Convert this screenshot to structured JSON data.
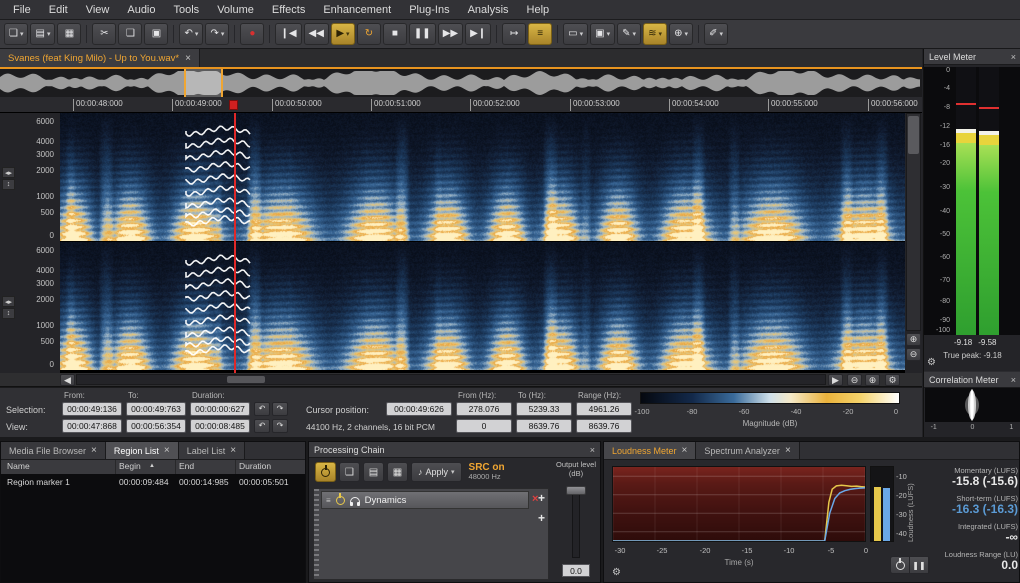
{
  "colors": {
    "accent_orange": "#f0a632",
    "meter_green": "#3cc43c",
    "shortterm_blue": "#5b9bd5",
    "momentary_yellow": "#e6c84b",
    "playhead_red": "#e02828"
  },
  "menu": {
    "items": [
      "File",
      "Edit",
      "View",
      "Audio",
      "Tools",
      "Volume",
      "Effects",
      "Enhancement",
      "Plug-Ins",
      "Analysis",
      "Help"
    ]
  },
  "icons": {
    "new_file": "❏",
    "open_folder": "▤",
    "save": "▦",
    "cut": "✂",
    "copy": "❑",
    "paste": "▣",
    "undo": "↶",
    "redo": "↷",
    "record": "●",
    "go_start": "❙◀",
    "rewind": "◀◀",
    "play": "▶",
    "loop": "↻",
    "stop": "■",
    "pause": "❚❚",
    "fast_forward": "▶▶",
    "go_end": "▶❙",
    "follow_playback": "↦",
    "spectrogram_view": "≡",
    "selection_tool": "▭",
    "region_tool": "▣",
    "draw_tool": "✎",
    "harmonics_tool": "≋",
    "zoom_tool": "⊕",
    "retouch_tool": "✐",
    "dropdown": "▾",
    "close": "×",
    "sort_asc": "▲",
    "zoom_in": "⊕",
    "zoom_out": "⊖",
    "settings": "⚙",
    "speaker": "♪",
    "drag_handle": "≡",
    "scroll_left": "◀",
    "scroll_right": "▶",
    "channel_updown": "↕",
    "channel_leftright": "◂▸",
    "remove": "×",
    "add": "+"
  },
  "document_tab": {
    "title": "Svanes (feat King Milo) - Up to You.wav*"
  },
  "timeline": {
    "labels": [
      "00:00:48:000",
      "00:00:49:000",
      "00:00:50:000",
      "00:00:51:000",
      "00:00:52:000",
      "00:00:53:000",
      "00:00:54:000",
      "00:00:55:000",
      "00:00:56:000"
    ]
  },
  "spectrogram": {
    "freq_labels": [
      "6000",
      "4000",
      "3000",
      "2000",
      "1000",
      "500",
      "0"
    ]
  },
  "info": {
    "headers": {
      "from": "From:",
      "to": "To:",
      "duration": "Duration:"
    },
    "selection": {
      "label": "Selection:",
      "from": "00:00:49:136",
      "to": "00:00:49:763",
      "duration": "00:00:00:627"
    },
    "view": {
      "label": "View:",
      "from": "00:00:47:868",
      "to": "00:00:56:354",
      "duration": "00:00:08:485"
    },
    "cursor_label": "Cursor position:",
    "cursor_value": "00:00:49:626",
    "format": "44100 Hz, 2 channels, 16 bit PCM",
    "freq_headers": {
      "from": "From (Hz):",
      "to": "To (Hz):",
      "range": "Range (Hz):"
    },
    "freq_selection": {
      "from": "278.076",
      "to": "5239.33",
      "range": "4961.26"
    },
    "freq_view": {
      "from": "0",
      "to": "8639.76",
      "range": "8639.76"
    },
    "magnitude_label": "Magnitude (dB)",
    "magnitude_ticks": [
      "-100",
      "-80",
      "-60",
      "-40",
      "-20",
      "0"
    ]
  },
  "level_meter": {
    "title": "Level Meter",
    "scale": [
      "0",
      "-4",
      "-8",
      "-12",
      "-16",
      "-20",
      "-30",
      "-40",
      "-50",
      "-60",
      "-70",
      "-80",
      "-90",
      "-100"
    ],
    "value_left": "-9.18",
    "value_right": "-9.58",
    "true_peak": "True peak: -9.18"
  },
  "correlation_meter": {
    "title": "Correlation Meter",
    "scale": [
      "-1",
      "0",
      "1"
    ]
  },
  "region_panel": {
    "tabs": [
      {
        "label": "Media File Browser"
      },
      {
        "label": "Region List"
      },
      {
        "label": "Label List"
      }
    ],
    "columns": [
      "Name",
      "Begin",
      "End",
      "Duration"
    ],
    "rows": [
      {
        "name": "Region marker 1",
        "begin": "00:00:09:484",
        "end": "00:00:14:985",
        "duration": "00:00:05:501"
      }
    ]
  },
  "processing_chain": {
    "title": "Processing Chain",
    "apply_label": "Apply",
    "src_status": "SRC on",
    "src_rate": "48000 Hz",
    "output_label": "Output level (dB)",
    "output_value": "0.0",
    "items": [
      {
        "name": "Dynamics"
      }
    ]
  },
  "analysis_panel": {
    "tabs": [
      {
        "label": "Loudness Meter"
      },
      {
        "label": "Spectrum Analyzer"
      }
    ],
    "stats": [
      {
        "label": "Momentary (LUFS)",
        "value": "-15.8 (-15.6)"
      },
      {
        "label": "Short-term (LUFS)",
        "value": "-16.3 (-16.3)"
      },
      {
        "label": "Integrated (LUFS)",
        "value": "-∞"
      },
      {
        "label": "Loudness Range (LU)",
        "value": "0.0"
      }
    ]
  },
  "chart_data": {
    "type": "line",
    "title": "Loudness history",
    "xlabel": "Time (s)",
    "ylabel": "Loudness (LUFS)",
    "xlim": [
      -30,
      0
    ],
    "ylim": [
      -45,
      -5
    ],
    "xticks": [
      -30,
      -25,
      -20,
      -15,
      -10,
      -5,
      0
    ],
    "yticks": [
      -10,
      -20,
      -30,
      -40
    ],
    "grid": true,
    "legend": "none",
    "series": [
      {
        "name": "Momentary (LUFS)",
        "color": "#e6c84b",
        "points": [
          [
            -30,
            -45
          ],
          [
            -4.8,
            -45
          ],
          [
            -4.3,
            -24
          ],
          [
            -3.9,
            -17
          ],
          [
            -3.4,
            -15.2
          ],
          [
            -2.8,
            -14.9
          ],
          [
            -2.2,
            -15.1
          ],
          [
            -1.6,
            -15.5
          ],
          [
            -1.0,
            -15.3
          ],
          [
            -0.5,
            -15.6
          ],
          [
            0,
            -15.8
          ]
        ]
      },
      {
        "name": "Short-term (LUFS)",
        "color": "#6aa8e8",
        "points": [
          [
            -30,
            -45
          ],
          [
            -4.8,
            -45
          ],
          [
            -4.2,
            -30
          ],
          [
            -3.6,
            -22
          ],
          [
            -3.0,
            -19
          ],
          [
            -2.4,
            -17.8
          ],
          [
            -1.8,
            -17.1
          ],
          [
            -1.2,
            -16.7
          ],
          [
            -0.6,
            -16.4
          ],
          [
            0,
            -16.3
          ]
        ]
      }
    ],
    "bars": [
      {
        "name": "Momentary",
        "color": "#e6c84b",
        "value": -15.8
      },
      {
        "name": "Short-term",
        "color": "#6aa8e8",
        "value": -16.3
      }
    ]
  }
}
